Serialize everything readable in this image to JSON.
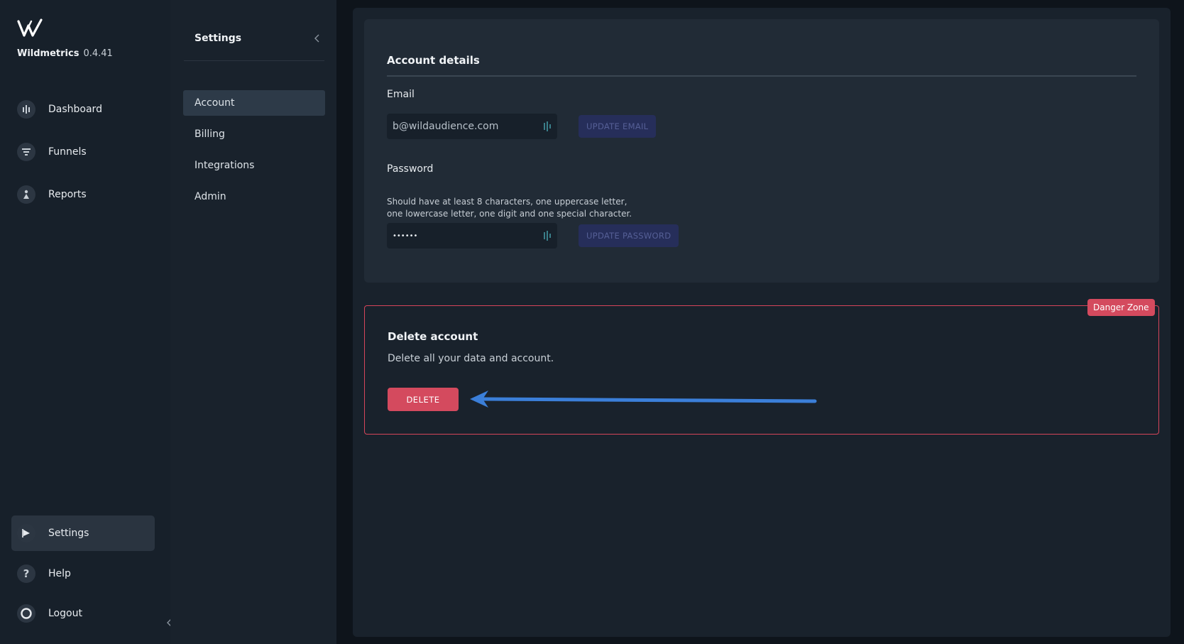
{
  "app": {
    "name": "Wildmetrics",
    "version": "0.4.41"
  },
  "nav": {
    "items": [
      {
        "label": "Dashboard",
        "icon": "bar-chart-icon"
      },
      {
        "label": "Funnels",
        "icon": "funnel-icon"
      },
      {
        "label": "Reports",
        "icon": "person-icon"
      }
    ],
    "bottom": [
      {
        "label": "Settings",
        "icon": "flag-icon",
        "active": true
      },
      {
        "label": "Help",
        "icon": "question-icon"
      },
      {
        "label": "Logout",
        "icon": "logout-icon"
      }
    ]
  },
  "settings_menu": {
    "title": "Settings",
    "items": [
      {
        "label": "Account",
        "active": true
      },
      {
        "label": "Billing"
      },
      {
        "label": "Integrations"
      },
      {
        "label": "Admin"
      }
    ]
  },
  "account": {
    "title": "Account details",
    "email_label": "Email",
    "email_value": "b@wildaudience.com",
    "update_email": "UPDATE EMAIL",
    "password_label": "Password",
    "password_hint": "Should have at least 8 characters, one uppercase letter, one lowercase letter, one digit and one special character.",
    "password_value": "••••••",
    "update_password": "UPDATE PASSWORD"
  },
  "danger": {
    "badge": "Danger Zone",
    "title": "Delete account",
    "description": "Delete all your data and account.",
    "delete_label": "DELETE"
  },
  "colors": {
    "danger": "#d44a5e",
    "arrow": "#3b7fd9",
    "disabled_button": "#262e5a"
  }
}
